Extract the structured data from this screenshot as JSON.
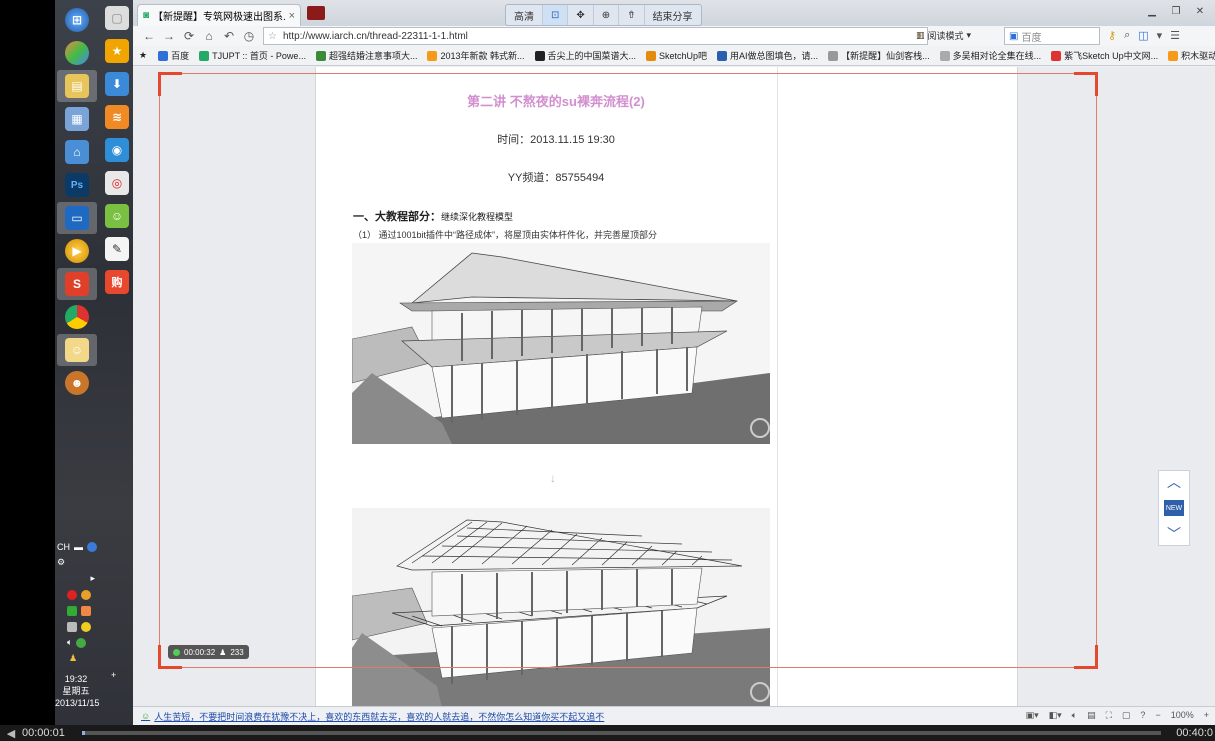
{
  "taskbar": {
    "clock_time": "19:32",
    "clock_day": "星期五",
    "clock_date": "2013/11/15",
    "tray_lang": "CH"
  },
  "browser": {
    "tab_title": "【新提醒】专筑网极速出图系...",
    "tab_close": "×",
    "float_tools": [
      "高清",
      "⊡",
      "✥",
      "⊕",
      "⇮",
      "结束分享"
    ],
    "url": "http://www.iarch.cn/thread-22311-1-1.html",
    "read_mode": "阅读模式",
    "search_placeholder": "百度",
    "bookmarks": [
      {
        "label": "百度",
        "color": "#2f6fd6"
      },
      {
        "label": "TJUPT :: 首页 - Powe...",
        "color": "#2a6"
      },
      {
        "label": "超强结婚注意事项大...",
        "color": "#3a8a3a"
      },
      {
        "label": "2013年新款 韩式新...",
        "color": "#f59b18"
      },
      {
        "label": "舌尖上的中国菜谱大...",
        "color": "#222"
      },
      {
        "label": "SketchUp吧",
        "color": "#e48b0e"
      },
      {
        "label": "用AI做总图填色，请...",
        "color": "#2a5fb0"
      },
      {
        "label": "【新提醒】仙剑客栈...",
        "color": "#999"
      },
      {
        "label": "多吴相对论全集在线...",
        "color": "#aaa"
      },
      {
        "label": "紫飞Sketch Up中文网...",
        "color": "#d33"
      },
      {
        "label": "积木驱动计算机...",
        "color": "#f59b18"
      }
    ]
  },
  "post": {
    "title": "第二讲 不熬夜的su裸奔流程(2)",
    "time": "时间：2013.11.15  19:30",
    "yy": "YY频道：85755494",
    "section_bold": "一、大教程部分：",
    "section_sub": "继续深化教程模型",
    "step": "（1）     通过1001bit插件中“路径成体”，将屋顶由实体杆件化，并完善屋顶部分",
    "arrow": "↓"
  },
  "recorder": {
    "elapsed": "00:00:32",
    "viewers": "233"
  },
  "side_nav": {
    "up": "︿",
    "new": "NEW",
    "down": "﹀"
  },
  "statusbar": {
    "news": "人生苦短，不要把时间浪费在犹豫不决上，喜欢的东西就去买，喜欢的人就去追，不然你怎么知道你买不起又追不",
    "zoom": "100%"
  },
  "player": {
    "current": "00:00:01",
    "total": "00:40:0",
    "progress": 0.0005
  }
}
